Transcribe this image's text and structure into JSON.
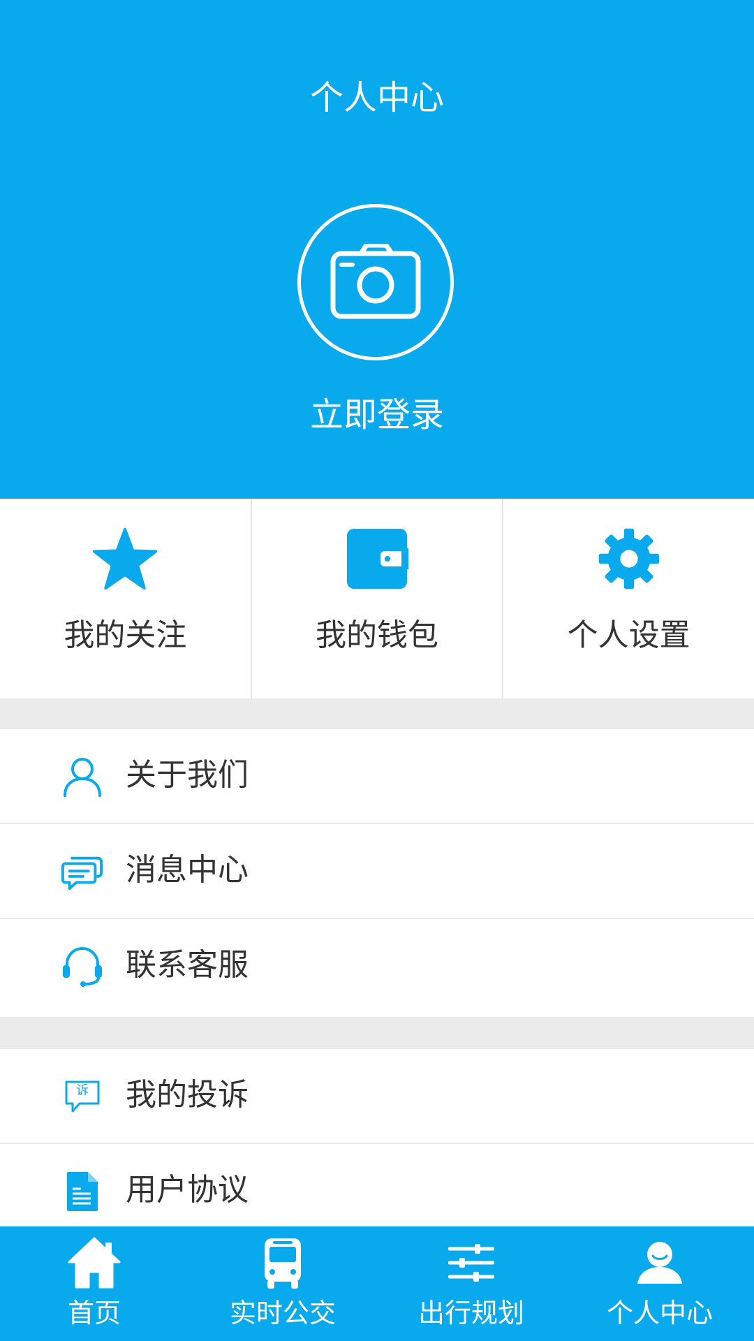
{
  "header": {
    "title": "个人中心",
    "login_label": "立即登录",
    "avatar_icon": "camera-icon"
  },
  "quick_actions": [
    {
      "label": "我的关注",
      "icon": "star-icon"
    },
    {
      "label": "我的钱包",
      "icon": "wallet-icon"
    },
    {
      "label": "个人设置",
      "icon": "gear-icon"
    }
  ],
  "menu_group_1": [
    {
      "label": "关于我们",
      "icon": "user-icon"
    },
    {
      "label": "消息中心",
      "icon": "chat-icon"
    },
    {
      "label": "联系客服",
      "icon": "headset-icon"
    }
  ],
  "menu_group_2": [
    {
      "label": "我的投诉",
      "icon": "complaint-icon",
      "icon_text": "诉"
    },
    {
      "label": "用户协议",
      "icon": "document-icon"
    }
  ],
  "tabbar": [
    {
      "label": "首页",
      "icon": "home-icon"
    },
    {
      "label": "实时公交",
      "icon": "bus-icon"
    },
    {
      "label": "出行规划",
      "icon": "sliders-icon"
    },
    {
      "label": "个人中心",
      "icon": "person-icon"
    }
  ],
  "colors": {
    "primary": "#09a9ee",
    "text": "#333333",
    "divider": "#e8e8e8",
    "gap": "#ebebeb"
  }
}
